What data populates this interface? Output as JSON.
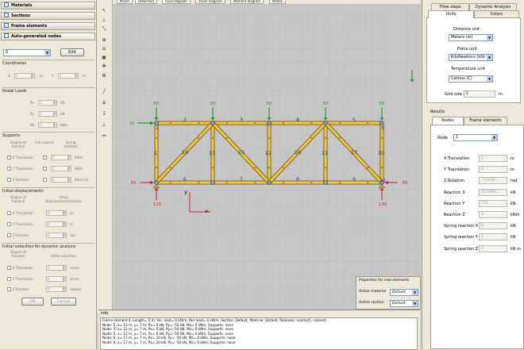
{
  "left": {
    "sections": [
      "Materials",
      "Sections",
      "Frame elements",
      "Auto-generated nodes"
    ],
    "node_select": "0",
    "edit_button": "Edit",
    "coordinates": {
      "title": "Coordinates",
      "x_label": "X",
      "x_value": "0",
      "x_unit": "m",
      "y_label": "Y",
      "y_value": "0",
      "y_unit": "m"
    },
    "nodal_loads": {
      "title": "Nodal Loads",
      "rows": [
        {
          "label": "Px",
          "value": "0",
          "unit": "kN"
        },
        {
          "label": "Py",
          "value": "0",
          "unit": "kN"
        },
        {
          "label": "Mz",
          "value": "0",
          "unit": "kNm"
        }
      ]
    },
    "supports": {
      "title": "Supports",
      "col1": "Degree of freedom",
      "col2": "Full support",
      "col3": "Spring constant",
      "rows": [
        {
          "label": "X Translation",
          "value": "0",
          "unit": "kN/m"
        },
        {
          "label": "Y Translation",
          "value": "0",
          "unit": "kN/m"
        },
        {
          "label": "Z Rotation",
          "value": "0",
          "unit": "kNm/rad"
        }
      ]
    },
    "initial_disp": {
      "title": "Initial displacements",
      "col1": "Degree of freedom",
      "col2": "Initial displacements/rotation",
      "rows": [
        {
          "label": "X Translation",
          "value": "0",
          "unit": "m"
        },
        {
          "label": "Y Translation",
          "value": "0",
          "unit": "m"
        },
        {
          "label": "Z Rotation",
          "value": "0",
          "unit": "rad"
        }
      ]
    },
    "initial_vel": {
      "title": "Initial velocities for dynamic analysis",
      "col1": "Degree of freedom",
      "col2": "Initial velocities",
      "rows": [
        {
          "label": "X Translation",
          "value": "0",
          "unit": "m/sec"
        },
        {
          "label": "Y Translation",
          "value": "0",
          "unit": "m/sec"
        },
        {
          "label": "Z Rotation",
          "value": "0",
          "unit": "rad/sec"
        }
      ]
    },
    "ok": "OK",
    "cancel": "Cancel"
  },
  "tabs": [
    "Model",
    "Deformed",
    "Axial diagram",
    "Shear diagram",
    "Moment diagram",
    "Modes"
  ],
  "model": {
    "top_loads": [
      "50",
      "50",
      "50",
      "50",
      "50"
    ],
    "left_load": "20",
    "left_reaction": "55",
    "right_reaction": "95",
    "bottom_reactions": [
      "115",
      "135"
    ],
    "top_labels": [
      "2",
      "3",
      "4",
      "5"
    ],
    "bottom_labels": [
      "6",
      "7",
      "8",
      "9"
    ],
    "vertical_labels": [
      "1",
      "13",
      "12",
      "11",
      "10"
    ],
    "diagonal_labels": [
      "14",
      "15",
      "16",
      "17"
    ],
    "node_labels": [
      "1",
      "2",
      "3",
      "4",
      "5",
      "6",
      "7",
      "8",
      "9",
      "10"
    ],
    "axis_x": "x",
    "axis_y": "y"
  },
  "props": {
    "title": "Properties for new elements",
    "material_label": "Active material",
    "material_value": "Default",
    "section_label": "Active section",
    "section_value": "Default"
  },
  "info": {
    "title": "Info",
    "lines": [
      "Frame element 4, Length= 5 m, Ver. load= 0 kN/m, Hor load= 0 kN/m, Section: Default, Material: Default, Releases: no(start), no(end)",
      "Node: 5, x= 12 m, y= 7 m, Px= 0 kN, Py= -50 kN, Mz= 0 kNm, Supports: none",
      "Node: 5, x= 12 m, y= 7 m, Px= 0 kN, Py= -50 kN, Mz= 0 kNm, Supports: none",
      "Node: 5, x= 12 m, y= 7 m, Px= 0 kN, Py= -50 kN, Mz= 0 kNm, Supports: none",
      "Node: 6, x= 17 m, y= 7 m, Px= 20 kN, Py= -50 kN, Mz= 0 kNm, Supports: none",
      "Node: 6, x= 17 m, y= 7 m, Px= 20 kN, Py= -50 kN, Mz= 0 kNm, Supports: none"
    ]
  },
  "right": {
    "top_tabs": [
      "Time steps",
      "Dynamic Analysis",
      "Units",
      "Colors"
    ],
    "distance_label": "Distance unit",
    "distance_value": "Meters (m)",
    "force_label": "Force unit",
    "force_value": "KiloNewtons (kN)",
    "temp_label": "Temperature unit",
    "temp_value": "Celsius (C)",
    "grid_label": "Grid size",
    "grid_value": "1",
    "grid_unit": "m",
    "results_title": "Results",
    "result_tabs": [
      "Nodes",
      "Frame elements"
    ],
    "node_label": "Node",
    "node_value": "1",
    "rows": [
      {
        "label": "X Translation",
        "value": "0",
        "unit": "m"
      },
      {
        "label": "Y Translation",
        "value": "0",
        "unit": "m"
      },
      {
        "label": "Z Rotation",
        "value": "-7.0339...",
        "unit": "rad"
      },
      {
        "label": "Reaction X",
        "value": "54.9999...",
        "unit": "kN"
      },
      {
        "label": "Reaction Y",
        "value": "115",
        "unit": "kN"
      },
      {
        "label": "Reaction Z",
        "value": "0",
        "unit": "kNm"
      },
      {
        "label": "Spring reaction X",
        "value": "0",
        "unit": "kN"
      },
      {
        "label": "Spring reaction Y",
        "value": "0",
        "unit": "kN"
      },
      {
        "label": "Spring reaction Z",
        "value": "0",
        "unit": "kN m"
      }
    ]
  },
  "colors": {
    "member": "#e8c84a",
    "member_edge": "#7a5a10",
    "node": "#e05050",
    "load_green": "#2a9a2a",
    "load_red": "#d03030",
    "axis": "#cc2222",
    "grid": "#bdbdbd"
  }
}
